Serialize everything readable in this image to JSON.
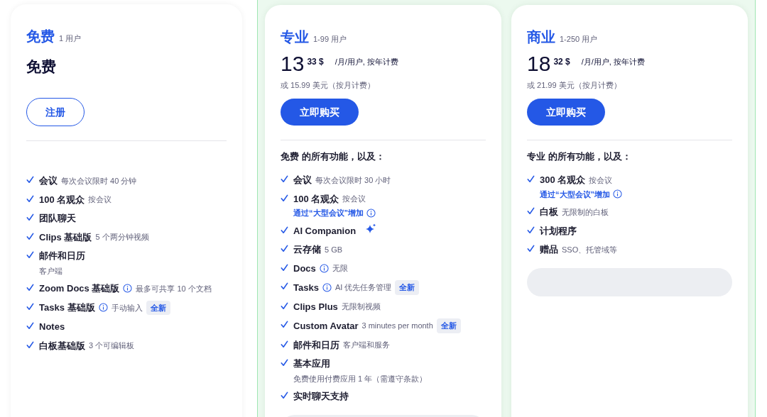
{
  "plans": [
    {
      "name": "免费",
      "users": "1 用户",
      "highlighted": false,
      "price": {
        "kind": "text",
        "text": "免费"
      },
      "button": {
        "label": "注册",
        "kind": "outline"
      },
      "footer_button": false,
      "features": [
        {
          "name": "会议",
          "detail": "每次会议限时 40 分钟"
        },
        {
          "name": "100 名观众",
          "detail": "按会议"
        },
        {
          "name": "团队聊天"
        },
        {
          "name": "Clips 基础版",
          "detail": "5 个两分钟视频"
        },
        {
          "name": "邮件和日历",
          "detail_below": "客户端"
        },
        {
          "name": "Zoom Docs 基础版",
          "info": true,
          "detail": "最多可共享 10 个文档"
        },
        {
          "name": "Tasks 基础版",
          "info": true,
          "detail": "手动输入",
          "badge": "全新"
        },
        {
          "name": "Notes"
        },
        {
          "name": "白板基础版",
          "detail": "3 个可编辑板"
        }
      ]
    },
    {
      "name": "专业",
      "users": "1-99 用户",
      "highlighted": true,
      "price": {
        "kind": "amount",
        "whole": "13",
        "cents": "33 $",
        "period": "/月/用户, 按年计费",
        "alt": "或 15.99 美元（按月计费）"
      },
      "button": {
        "label": "立即购买",
        "kind": "solid"
      },
      "footer_button": true,
      "intro": "免费 的所有功能，以及：",
      "features": [
        {
          "name": "会议",
          "detail": "每次会议限时 30 小时"
        },
        {
          "name": "100 名观众",
          "detail": "按会议",
          "link": "通过“大型会议”增加"
        },
        {
          "name": "AI Companion",
          "sparkle": true
        },
        {
          "name": "云存储",
          "detail": "5 GB"
        },
        {
          "name": "Docs",
          "info": true,
          "detail": "无限"
        },
        {
          "name": "Tasks",
          "info": true,
          "detail": "AI 优先任务管理",
          "badge": "全新"
        },
        {
          "name": "Clips Plus",
          "detail": "无限制视频"
        },
        {
          "name": "Custom Avatar",
          "detail": "3 minutes per month",
          "badge": "全新"
        },
        {
          "name": "邮件和日历",
          "detail": "客户端和服务"
        },
        {
          "name": "基本应用",
          "detail_below": "免费使用付费应用 1 年（需遵守条款）"
        },
        {
          "name": "实时聊天支持"
        }
      ]
    },
    {
      "name": "商业",
      "users": "1-250 用户",
      "highlighted": true,
      "price": {
        "kind": "amount",
        "whole": "18",
        "cents": "32 $",
        "period": "/月/用户, 按年计费",
        "alt": "或 21.99 美元（按月计费）"
      },
      "button": {
        "label": "立即购买",
        "kind": "solid"
      },
      "footer_button": true,
      "intro": "专业 的所有功能，以及：",
      "features": [
        {
          "name": "300 名观众",
          "detail": "按会议",
          "link": "通过“大型会议”增加"
        },
        {
          "name": "白板",
          "detail": "无限制的白板"
        },
        {
          "name": "计划程序"
        },
        {
          "name": "赠品",
          "detail": "SSO、托管域等"
        }
      ]
    }
  ]
}
